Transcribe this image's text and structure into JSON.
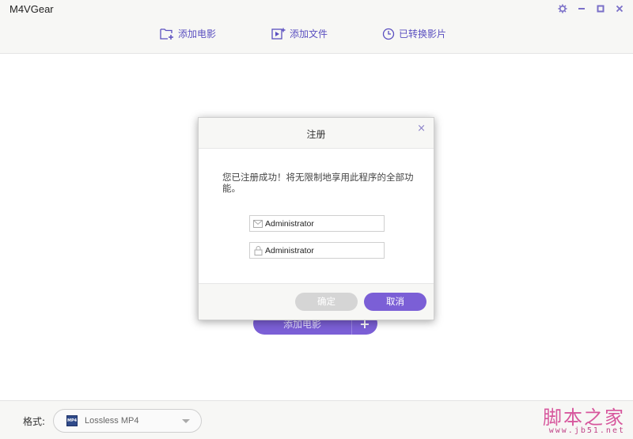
{
  "app": {
    "title": "M4VGear"
  },
  "window_controls": {
    "icons": [
      "gear-icon",
      "minimize-icon",
      "maximize-icon",
      "close-icon"
    ],
    "accent": "#7a6fc8"
  },
  "toolbar": {
    "add_movie": "添加电影",
    "add_file": "添加文件",
    "converted": "已转换影片",
    "accent": "#5a4fc0"
  },
  "main": {
    "add_movie_button": "添加电影",
    "add_more": "+"
  },
  "footer": {
    "format_label": "格式:",
    "format_value": "Lossless MP4",
    "format_icon_text": "MP4"
  },
  "watermark": {
    "text": "脚本之家",
    "url": "www.jb51.net"
  },
  "dialog": {
    "title": "注册",
    "close": "×",
    "message": "您已注册成功！将无限制地享用此程序的全部功能。",
    "email_value": "Administrator",
    "code_value": "Administrator",
    "ok_label": "确定",
    "cancel_label": "取消",
    "colors": {
      "primary": "#7b5fd6",
      "disabled": "#d5d5d5"
    }
  }
}
